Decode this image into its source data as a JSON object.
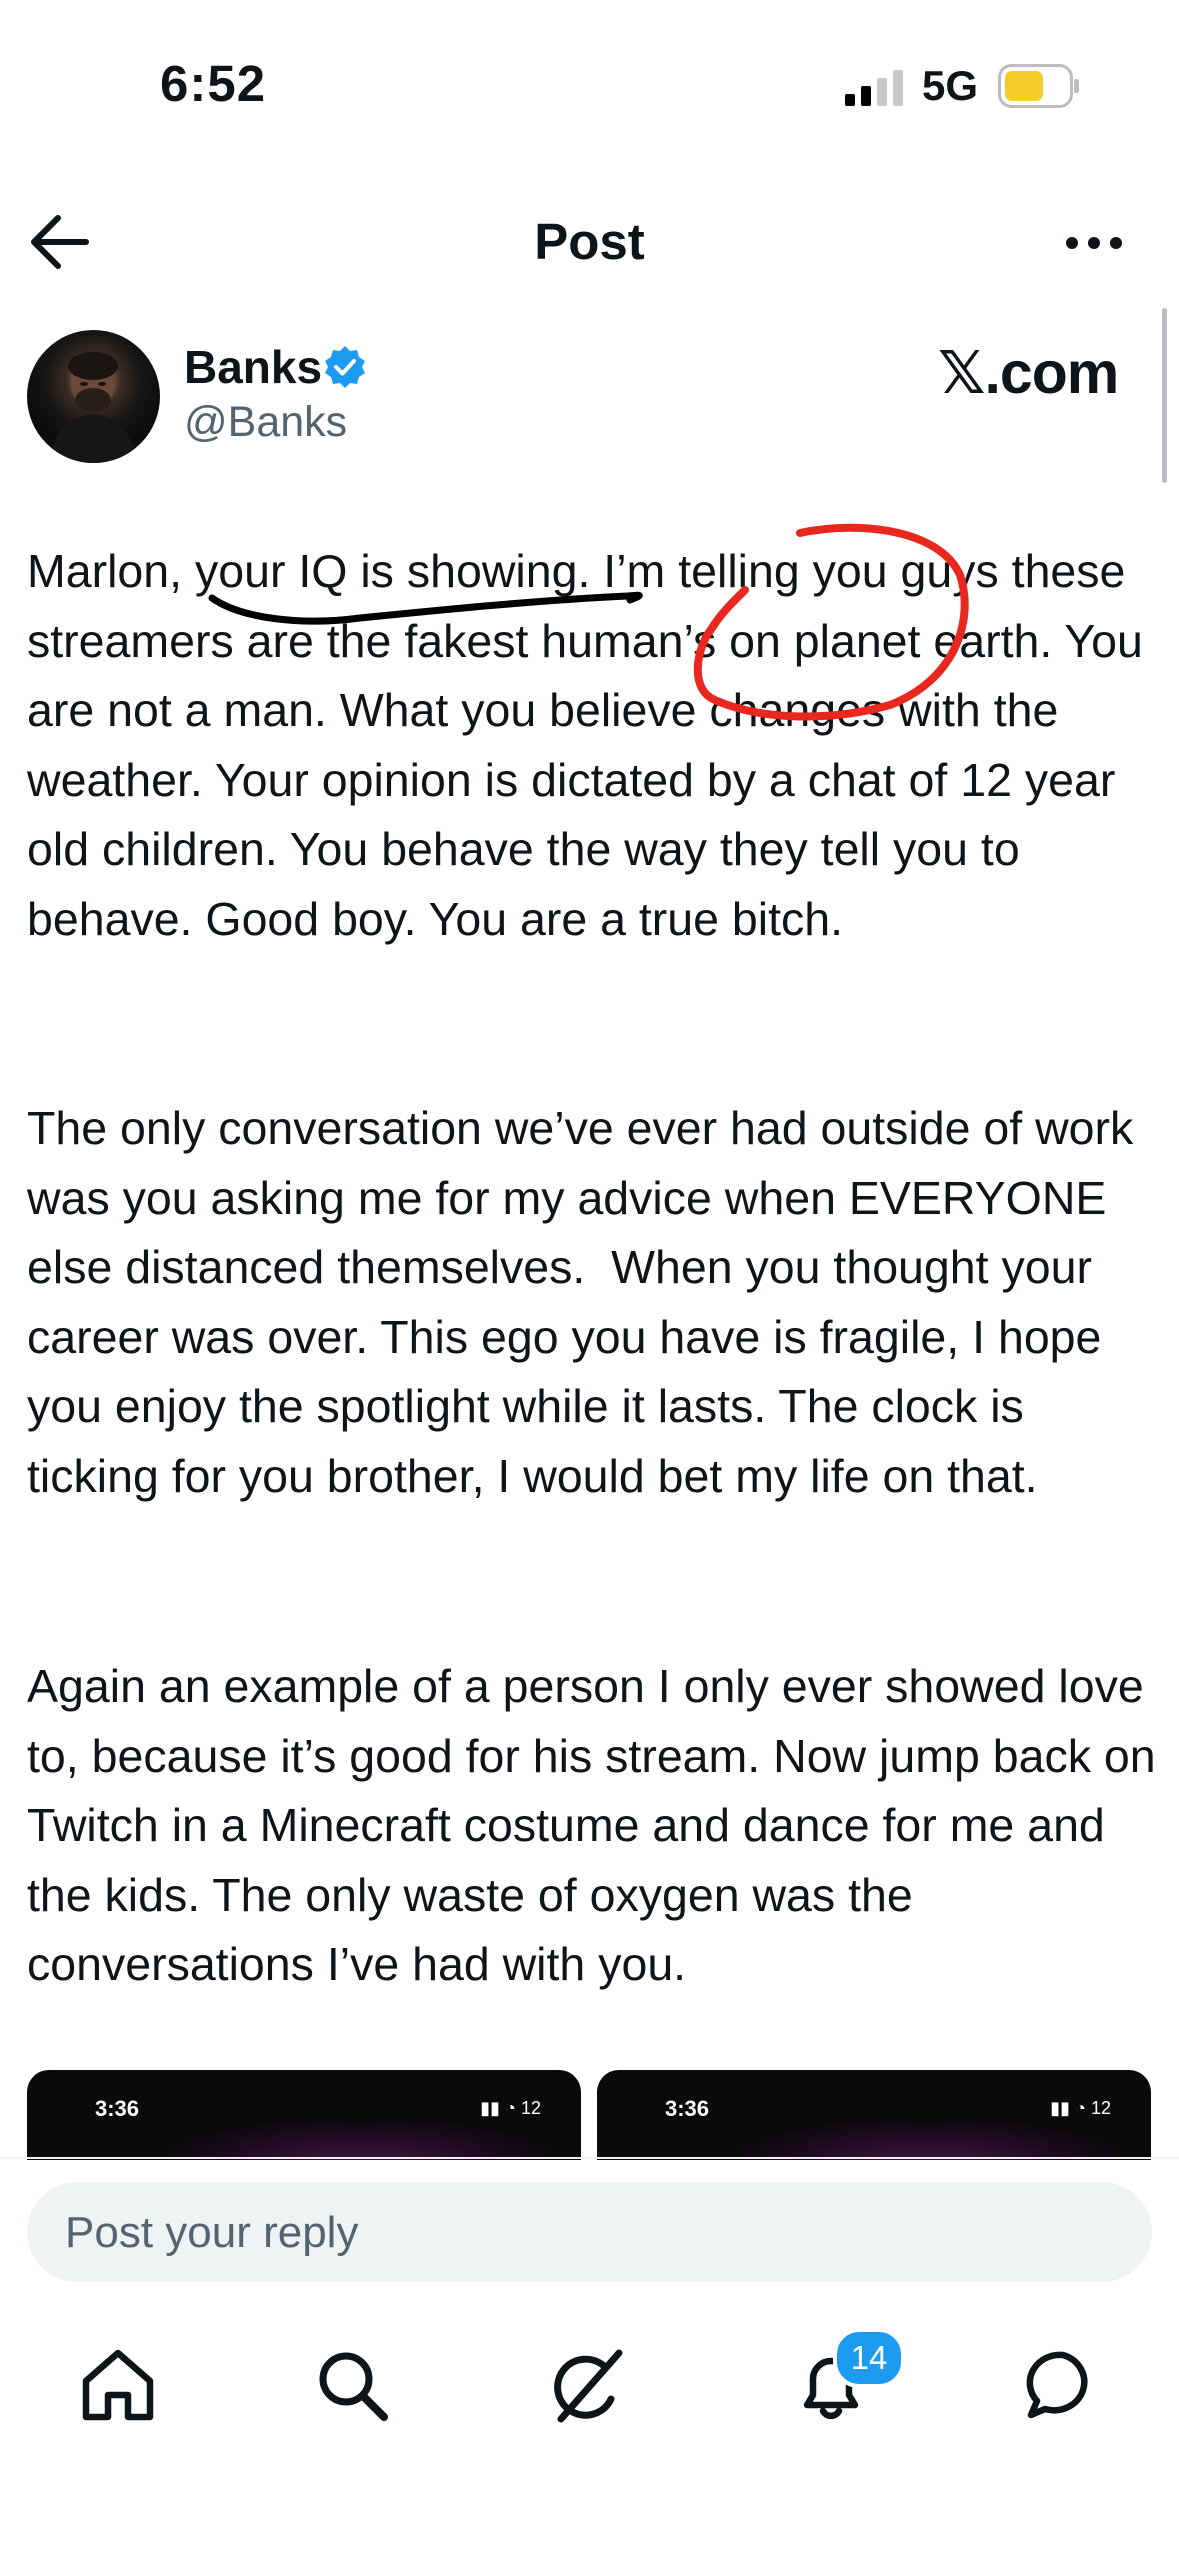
{
  "status_bar": {
    "time": "6:52",
    "network": "5G"
  },
  "header": {
    "title": "Post"
  },
  "author": {
    "name": "Banks",
    "handle": "@Banks",
    "watermark": "𝕏.com"
  },
  "post": {
    "paragraphs": [
      "Marlon, your IQ is showing. I’m telling you guys these streamers are the fakest human’s on planet earth. You are not a man. What you believe changes with the weather. Your opinion is dictated by a chat of 12 year old children. You behave the way they tell you to behave. Good boy. You are a true bitch.",
      "The only conversation we’ve ever had outside of work was you asking me for my advice when EVERYONE else distanced themselves.  When you thought your career was over. This ego you have is fragile, I hope you enjoy the spotlight while it lasts. The clock is ticking for you brother, I would bet my life on that.",
      "Again an example of a person I only ever showed love to, because it’s good for his stream. Now jump back on Twitch in a Minecraft costume and dance for me and the kids. The only waste of oxygen was the conversations I’ve had with you."
    ],
    "media": [
      {
        "time": "3:36",
        "battery": "12"
      },
      {
        "time": "3:36",
        "battery": "12"
      }
    ]
  },
  "reply": {
    "placeholder": "Post your reply"
  },
  "nav": {
    "items": [
      "home-icon",
      "search-icon",
      "grok-icon",
      "bell-icon",
      "messages-icon"
    ],
    "notification_count": "14"
  },
  "colors": {
    "accent": "#1d9bf0",
    "text": "#0f1419",
    "muted": "#536471",
    "annotation_red": "#e8281e",
    "annotation_black": "#000000"
  }
}
